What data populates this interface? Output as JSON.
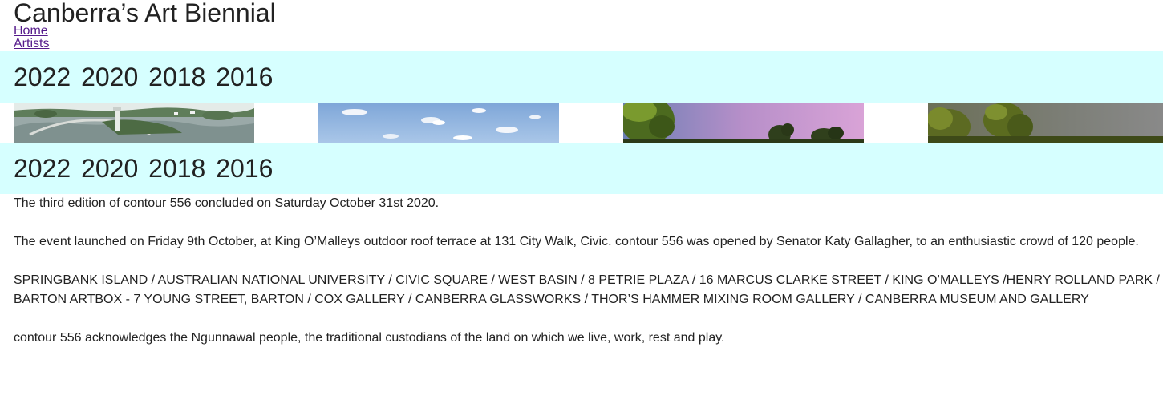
{
  "site": {
    "title": "Canberra’s Art Biennial"
  },
  "nav": {
    "items": [
      {
        "label": "Home"
      },
      {
        "label": "Artists"
      }
    ]
  },
  "years": [
    "2022",
    "2020",
    "2018",
    "2016"
  ],
  "images": [
    {
      "icon": "springbank-island-lake-image"
    },
    {
      "icon": "blue-sky-clouds-image"
    },
    {
      "icon": "pink-sunset-trees-image"
    },
    {
      "icon": "stormy-sky-trees-image"
    }
  ],
  "content": {
    "p1": "The third edition of contour 556 concluded on Saturday October 31st 2020.",
    "p2": "The event launched on Friday 9th October, at King O’Malleys outdoor roof terrace at 131 City Walk, Civic. contour 556 was opened by Senator Katy Gallagher, to an enthusiastic crowd of 120 people.",
    "p3": "SPRINGBANK ISLAND / AUSTRALIAN NATIONAL UNIVERSITY / CIVIC SQUARE / WEST BASIN / 8 PETRIE PLAZA / 16 MARCUS CLARKE STREET / KING O’MALLEYS /HENRY ROLLAND PARK / BARTON ARTBOX - 7 YOUNG STREET, BARTON / COX GALLERY / CANBERRA GLASSWORKS / THOR’S HAMMER MIXING ROOM GALLERY / CANBERRA MUSEUM AND GALLERY",
    "p4": "contour 556 acknowledges the Ngunnawal people, the traditional custodians of the land on which we live, work, rest and play."
  },
  "colors": {
    "band": "#d6ffff",
    "link": "#551a8b",
    "text": "#222222"
  }
}
